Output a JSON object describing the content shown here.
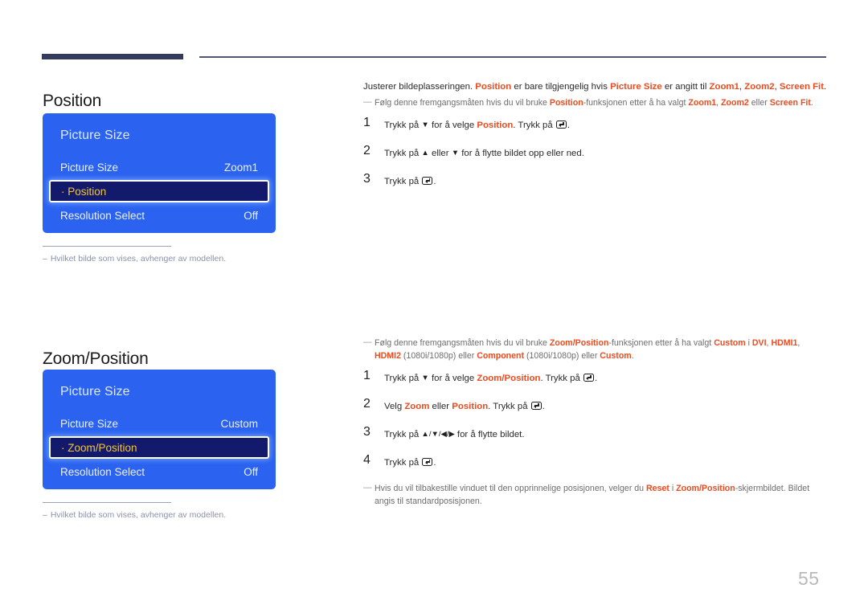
{
  "page": {
    "number": "55"
  },
  "sections": [
    {
      "heading": "Position",
      "panel": {
        "title": "Picture Size",
        "rows": [
          {
            "label": "Picture Size",
            "value": "Zoom1",
            "selected": false
          },
          {
            "label": "· Position",
            "value": "",
            "selected": true
          },
          {
            "label": "Resolution Select",
            "value": "Off",
            "selected": false
          }
        ]
      },
      "caption": {
        "dash": "–",
        "text": "Hvilket bilde som vises, avhenger av modellen."
      },
      "intro": {
        "t1": "Justerer bildeplasseringen. ",
        "k1": "Position",
        "t2": " er bare tilgjengelig hvis ",
        "k2": "Picture Size",
        "t3": " er angitt til ",
        "k3": "Zoom1",
        "t4": ", ",
        "k4": "Zoom2",
        "t5": ", ",
        "k5": "Screen Fit",
        "t6": "."
      },
      "note": {
        "marker": "—",
        "t1": "Følg denne fremgangsmåten hvis du vil bruke ",
        "k1": "Position",
        "t2": "-funksjonen etter å ha valgt ",
        "k2": "Zoom1",
        "t3": ", ",
        "k3": "Zoom2",
        "t4": " eller ",
        "k4": "Screen Fit",
        "t5": "."
      },
      "steps": [
        {
          "num": "1",
          "t1": "Trykk på ",
          "arrow1": "▼",
          "t2": " for å velge ",
          "k1": "Position",
          "t3": ". Trykk på ",
          "t4": "."
        },
        {
          "num": "2",
          "t1": "Trykk på ",
          "arrow1": "▲",
          "t2": " eller ",
          "arrow2": "▼",
          "t3": " for å flytte bildet opp eller ned."
        },
        {
          "num": "3",
          "t1": "Trykk på ",
          "t4": "."
        }
      ]
    },
    {
      "heading": "Zoom/Position",
      "panel": {
        "title": "Picture Size",
        "rows": [
          {
            "label": "Picture Size",
            "value": "Custom",
            "selected": false
          },
          {
            "label": "· Zoom/Position",
            "value": "",
            "selected": true
          },
          {
            "label": "Resolution Select",
            "value": "Off",
            "selected": false
          }
        ]
      },
      "caption": {
        "dash": "–",
        "text": "Hvilket bilde som vises, avhenger av modellen."
      },
      "note": {
        "marker": "—",
        "t1": "Følg denne fremgangsmåten hvis du vil bruke ",
        "k1": "Zoom/Position",
        "t2": "-funksjonen etter å ha valgt ",
        "k2": "Custom",
        "t3": " i ",
        "k3": "DVI",
        "t4": ", ",
        "k4": "HDMI1",
        "t5": ", ",
        "k5": "HDMI2",
        "t6": " (1080i/1080p) eller ",
        "k6": "Component",
        "t7": " (1080i/1080p) eller ",
        "k7": "Custom",
        "t8": "."
      },
      "steps": [
        {
          "num": "1",
          "t1": "Trykk på ",
          "arrow1": "▼",
          "t2": " for å velge ",
          "k1": "Zoom/Position",
          "t3": ". Trykk på ",
          "t4": "."
        },
        {
          "num": "2",
          "t1": "Velg ",
          "k1": "Zoom",
          "t2": " eller ",
          "k2": "Position",
          "t3": ". Trykk på ",
          "t4": "."
        },
        {
          "num": "3",
          "t1": "Trykk på ",
          "arrows": "▲/▼/◀/▶",
          "t2": " for å flytte bildet."
        },
        {
          "num": "4",
          "t1": "Trykk på ",
          "t4": "."
        }
      ],
      "endnote": {
        "marker": "—",
        "t1": "Hvis du vil tilbakestille vinduet til den opprinnelige posisjonen, velger du ",
        "k1": "Reset",
        "t2": " i ",
        "k2": "Zoom/Position",
        "t3": "-skjermbildet. Bildet angis til standardposisjonen."
      }
    }
  ]
}
